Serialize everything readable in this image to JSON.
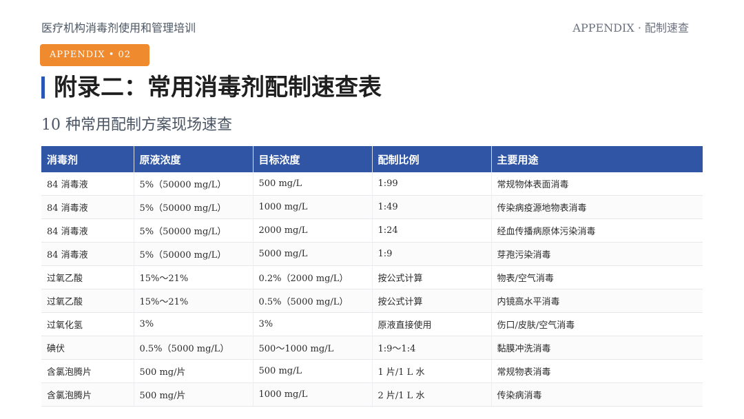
{
  "header": {
    "course": "医疗机构消毒剂使用和管理培训",
    "section": "APPENDIX · 配制速查"
  },
  "badge": "APPENDIX • 02",
  "title": "附录二：常用消毒剂配制速查表",
  "subtitle": "10 种常用配制方案现场速查",
  "colors": {
    "header_bg": "#2f55a4",
    "badge_bg": "#f08a2e",
    "accent_bar": "#2a56b8"
  },
  "table": {
    "columns": [
      "消毒剂",
      "原液浓度",
      "目标浓度",
      "配制比例",
      "主要用途"
    ],
    "rows": [
      [
        "84 消毒液",
        "5%（50000 mg/L）",
        "500 mg/L",
        "1:99",
        "常规物体表面消毒"
      ],
      [
        "84 消毒液",
        "5%（50000 mg/L）",
        "1000 mg/L",
        "1:49",
        "传染病疫源地物表消毒"
      ],
      [
        "84 消毒液",
        "5%（50000 mg/L）",
        "2000 mg/L",
        "1:24",
        "经血传播病原体污染消毒"
      ],
      [
        "84 消毒液",
        "5%（50000 mg/L）",
        "5000 mg/L",
        "1:9",
        "芽孢污染消毒"
      ],
      [
        "过氧乙酸",
        "15%～21%",
        "0.2%（2000 mg/L）",
        "按公式计算",
        "物表/空气消毒"
      ],
      [
        "过氧乙酸",
        "15%～21%",
        "0.5%（5000 mg/L）",
        "按公式计算",
        "内镜高水平消毒"
      ],
      [
        "过氧化氢",
        "3%",
        "3%",
        "原液直接使用",
        "伤口/皮肤/空气消毒"
      ],
      [
        "碘伏",
        "0.5%（5000 mg/L）",
        "500～1000 mg/L",
        "1:9～1:4",
        "黏膜冲洗消毒"
      ],
      [
        "含氯泡腾片",
        "500 mg/片",
        "500 mg/L",
        "1 片/1 L 水",
        "常规物表消毒"
      ],
      [
        "含氯泡腾片",
        "500 mg/片",
        "1000 mg/L",
        "2 片/1 L 水",
        "传染病消毒"
      ]
    ]
  }
}
